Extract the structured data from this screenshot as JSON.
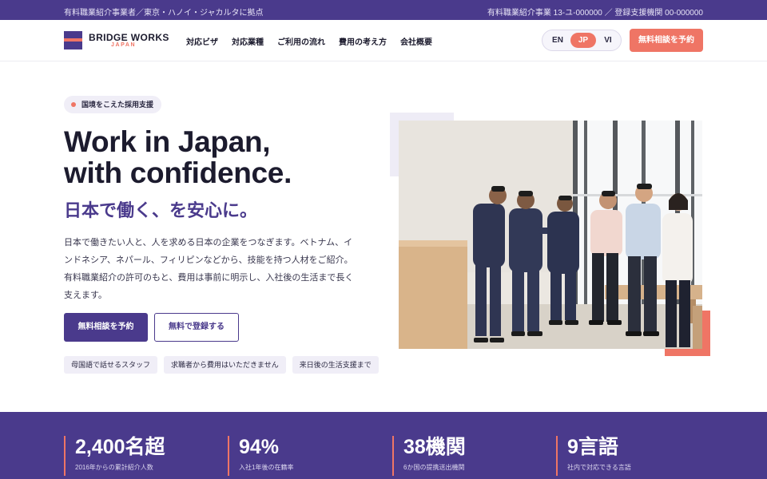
{
  "topbar": {
    "left_text": "有料職業紹介事業者／東京・ハノイ・ジャカルタに拠点",
    "right_text": "有料職業紹介事業 13-ユ-000000 ／ 登録支援機関 00-000000"
  },
  "header": {
    "logo_name": "BRIDGE WORKS",
    "logo_sub": "JAPAN",
    "nav": [
      "対応ビザ",
      "対応業種",
      "ご利用の流れ",
      "費用の考え方",
      "会社概要"
    ],
    "languages": [
      "EN",
      "JP",
      "VI"
    ],
    "active_language": "JP",
    "cta_label": "無料相談を予約"
  },
  "hero": {
    "tag": "国境をこえた採用支援",
    "headline_line1": "Work in Japan,",
    "headline_line2": "with confidence.",
    "subheadline": "日本で働く、を安心に。",
    "description": "日本で働きたい人と、人を求める日本の企業をつなぎます。ベトナム、インドネシア、ネパール、フィリピンなどから、技能を持つ人材をご紹介。有料職業紹介の許可のもと、費用は事前に明示し、入社後の生活まで長く支えます。",
    "primary_button": "無料相談を予約",
    "secondary_button": "無料で登録する",
    "features": [
      "母国語で話せるスタッフ",
      "求職者から費用はいただきません",
      "来日後の生活支援まで"
    ]
  },
  "stats": [
    {
      "value": "2,400名超",
      "caption": "2016年からの累計紹介人数"
    },
    {
      "value": "94%",
      "caption": "入社1年後の在籍率"
    },
    {
      "value": "38機関",
      "caption": "6か国の提携送出機関"
    },
    {
      "value": "9言語",
      "caption": "社内で対応できる言語"
    }
  ],
  "colors": {
    "brand": "#4a3a8c",
    "accent": "#ef7565",
    "tint": "#f0eef7"
  }
}
